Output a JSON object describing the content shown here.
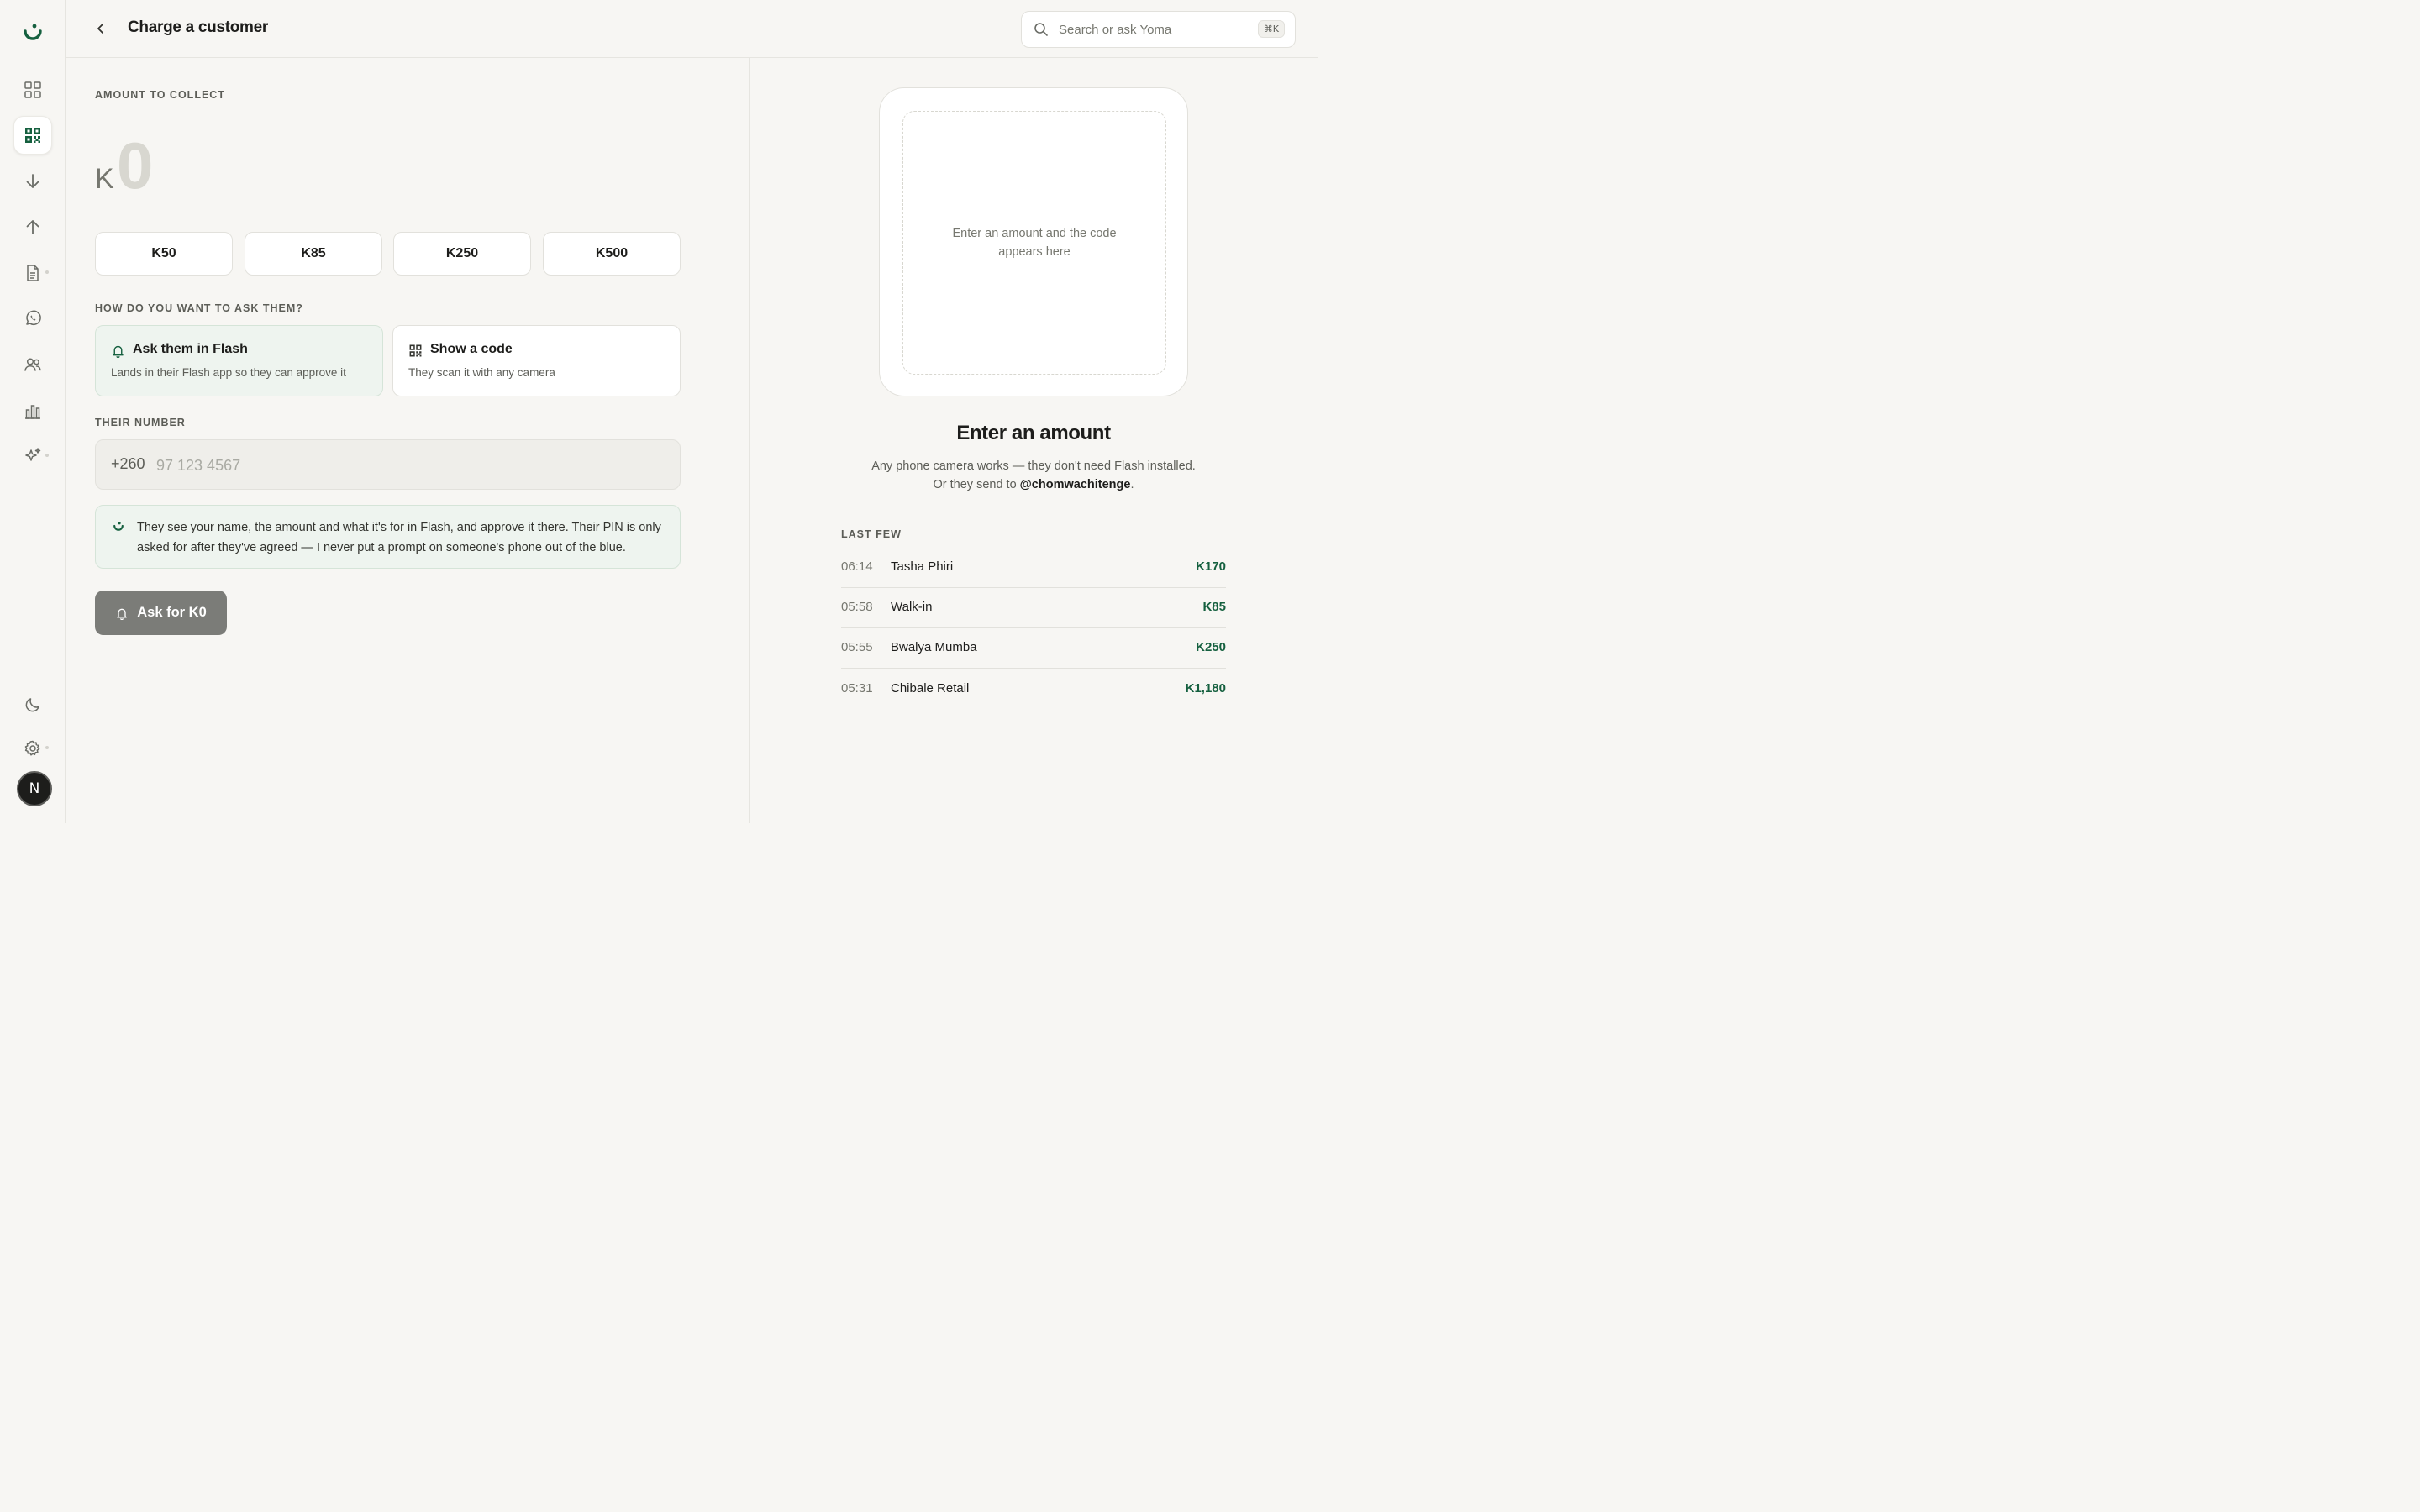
{
  "header": {
    "title": "Charge a customer",
    "search_placeholder": "Search or ask Yoma",
    "search_shortcut": "⌘K"
  },
  "sidebar": {
    "items": [
      {
        "icon": "dashboard-icon"
      },
      {
        "icon": "qr-code-icon",
        "active": true
      },
      {
        "icon": "arrow-down-icon"
      },
      {
        "icon": "arrow-up-icon"
      },
      {
        "icon": "document-icon"
      },
      {
        "icon": "whatsapp-icon"
      },
      {
        "icon": "users-icon"
      },
      {
        "icon": "bar-chart-icon"
      },
      {
        "icon": "sparkles-icon"
      }
    ],
    "bottom": [
      {
        "icon": "moon-icon"
      },
      {
        "icon": "gear-icon"
      }
    ],
    "avatar_letter": "N",
    "accent": "#15603f"
  },
  "form": {
    "amount_label": "AMOUNT TO COLLECT",
    "currency": "K",
    "amount": "0",
    "presets": [
      "K50",
      "K85",
      "K250",
      "K500"
    ],
    "method_label": "HOW DO YOU WANT TO ASK THEM?",
    "methods": [
      {
        "title": "Ask them in Flash",
        "desc": "Lands in their Flash app so they can approve it",
        "selected": true,
        "icon": "bell-icon"
      },
      {
        "title": "Show a code",
        "desc": "They scan it with any camera",
        "selected": false,
        "icon": "qr-code-icon"
      }
    ],
    "number_label": "THEIR NUMBER",
    "country_code": "+260",
    "number_placeholder": "97 123 4567",
    "notice": "They see your name, the amount and what it's for in Flash, and approve it there. Their PIN is only asked for after they've agreed — I never put a prompt on someone's phone out of the blue.",
    "submit_label": "Ask for K0"
  },
  "preview": {
    "placeholder": "Enter an amount and the code appears here",
    "title": "Enter an amount",
    "sub_line1": "Any phone camera works — they don't need Flash installed.",
    "sub_line2_prefix": "Or they send to ",
    "handle": "@chomwachitenge",
    "sub_line2_suffix": "."
  },
  "recent": {
    "label": "LAST FEW",
    "rows": [
      {
        "time": "06:14",
        "name": "Tasha Phiri",
        "amount": "K170"
      },
      {
        "time": "05:58",
        "name": "Walk-in",
        "amount": "K85"
      },
      {
        "time": "05:55",
        "name": "Bwalya Mumba",
        "amount": "K250"
      },
      {
        "time": "05:31",
        "name": "Chibale Retail",
        "amount": "K1,180"
      }
    ]
  }
}
